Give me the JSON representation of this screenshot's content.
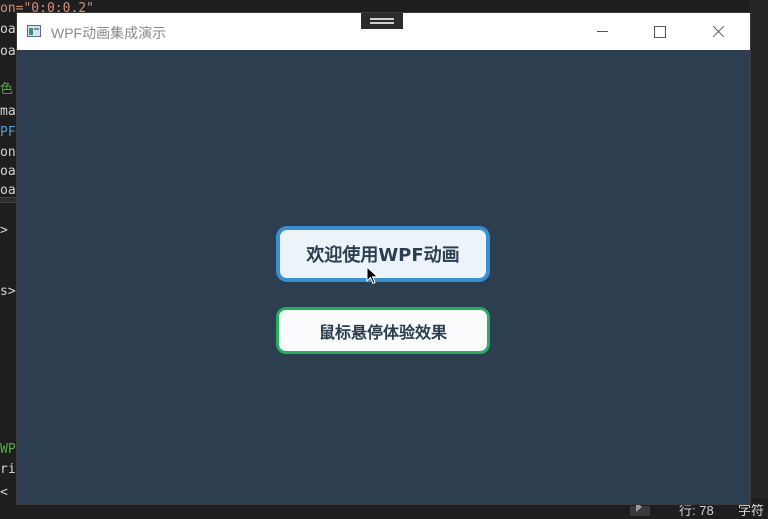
{
  "window": {
    "title": "WPF动画集成演示"
  },
  "buttons": {
    "primary_label": "欢迎使用WPF动画",
    "secondary_label": "鼠标悬停体验效果"
  },
  "editor": {
    "lines": [
      "on=\"0:0:0.2\"",
      "oa",
      "oa",
      "",
      "色",
      "mat",
      "PF",
      "on",
      "oa",
      "oa",
      ">",
      "s>",
      "WP",
      "riz",
      "<"
    ]
  },
  "status": {
    "line": "行: 78",
    "char": "字符"
  },
  "colors": {
    "window_bg": "#2c3e50",
    "primary_border": "#3a8fd0",
    "secondary_border": "#27ae60",
    "button_text": "#2c3e50"
  }
}
